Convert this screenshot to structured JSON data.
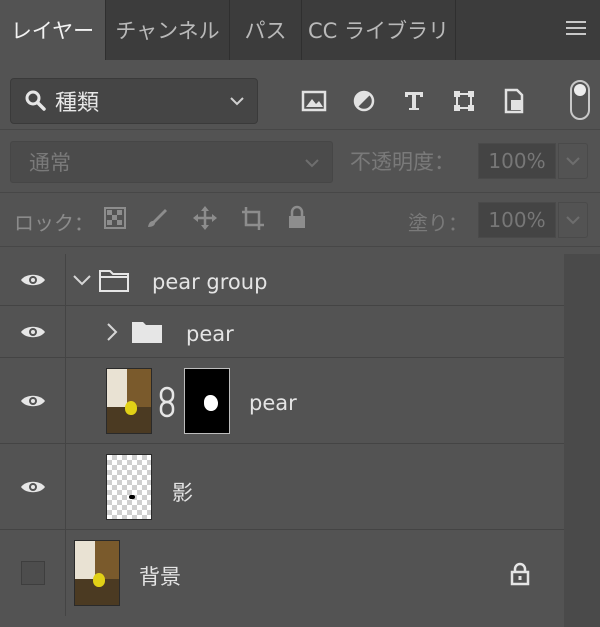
{
  "tabs": [
    {
      "label": "レイヤー",
      "active": true
    },
    {
      "label": "チャンネル",
      "active": false
    },
    {
      "label": "パス",
      "active": false
    },
    {
      "label": "CC ライブラリ",
      "active": false
    }
  ],
  "filter": {
    "kind_label": "種類"
  },
  "blend": {
    "mode": "通常",
    "opacity_label": "不透明度：",
    "opacity_value": "100%"
  },
  "lock": {
    "label": "ロック：",
    "fill_label": "塗り：",
    "fill_value": "100%"
  },
  "layers": [
    {
      "name": "pear group",
      "visible": true,
      "type": "group",
      "expanded": true
    },
    {
      "name": "pear",
      "visible": true,
      "type": "group",
      "expanded": false
    },
    {
      "name": "pear",
      "visible": true,
      "type": "image-with-mask"
    },
    {
      "name": "影",
      "visible": true,
      "type": "transparent"
    },
    {
      "name": "背景",
      "visible": false,
      "type": "background",
      "locked": true
    }
  ],
  "colors": {
    "panel": "#535353",
    "tabbar": "#3c3c3c",
    "text": "#e4e4e4"
  }
}
